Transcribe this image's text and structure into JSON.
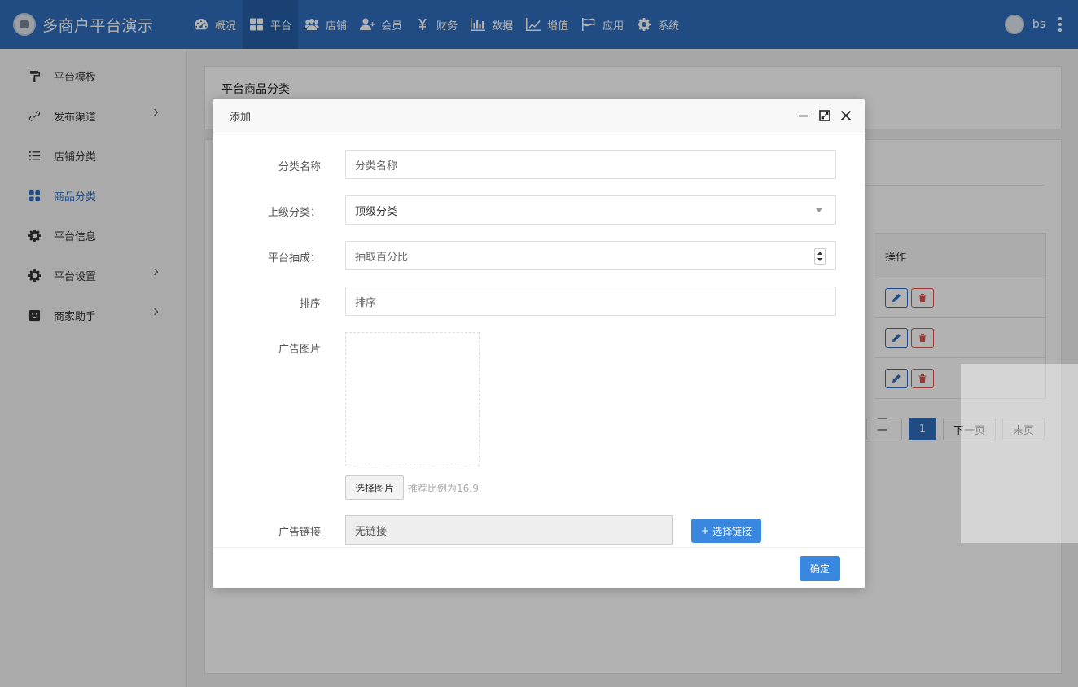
{
  "brand": {
    "title": "多商户平台演示"
  },
  "nav": {
    "items": [
      {
        "label": "概况",
        "icon": "dashboard-icon"
      },
      {
        "label": "平台",
        "icon": "grid-icon",
        "active": true
      },
      {
        "label": "店铺",
        "icon": "users-icon"
      },
      {
        "label": "会员",
        "icon": "user-plus-icon"
      },
      {
        "label": "财务",
        "icon": "yen-icon"
      },
      {
        "label": "数据",
        "icon": "bar-chart-icon"
      },
      {
        "label": "增值",
        "icon": "line-chart-icon"
      },
      {
        "label": "应用",
        "icon": "flag-icon"
      },
      {
        "label": "系统",
        "icon": "gear-icon"
      }
    ]
  },
  "user": {
    "name": "bs"
  },
  "sidebar": {
    "items": [
      {
        "label": "平台模板",
        "icon": "paint-roller-icon"
      },
      {
        "label": "发布渠道",
        "icon": "link-icon",
        "has_sub": true
      },
      {
        "label": "店铺分类",
        "icon": "list-icon"
      },
      {
        "label": "商品分类",
        "icon": "apps-icon",
        "active": true
      },
      {
        "label": "平台信息",
        "icon": "gear-icon"
      },
      {
        "label": "平台设置",
        "icon": "gear-icon",
        "has_sub": true
      },
      {
        "label": "商家助手",
        "icon": "robot-icon",
        "has_sub": true
      }
    ]
  },
  "page": {
    "title": "平台商品分类",
    "table": {
      "ops_header": "操作"
    },
    "pager": {
      "prev": "上一页",
      "current": "1",
      "next": "下一页",
      "last": "末页"
    }
  },
  "modal": {
    "title": "添加",
    "fields": {
      "name": {
        "label": "分类名称",
        "placeholder": "分类名称"
      },
      "parent": {
        "label": "上级分类：",
        "value": "顶级分类"
      },
      "commission": {
        "label": "平台抽成：",
        "placeholder": "抽取百分比"
      },
      "sort": {
        "label": "排序",
        "placeholder": "排序"
      },
      "ad_image": {
        "label": "广告图片",
        "button": "选择图片",
        "hint": "推荐比例为16:9"
      },
      "ad_link": {
        "label": "广告链接",
        "value": "无链接",
        "button": "选择链接"
      }
    },
    "confirm": "确定"
  },
  "colors": {
    "primary": "#2f6ebc",
    "button_blue": "#3a87e0",
    "danger": "#d9534f"
  }
}
